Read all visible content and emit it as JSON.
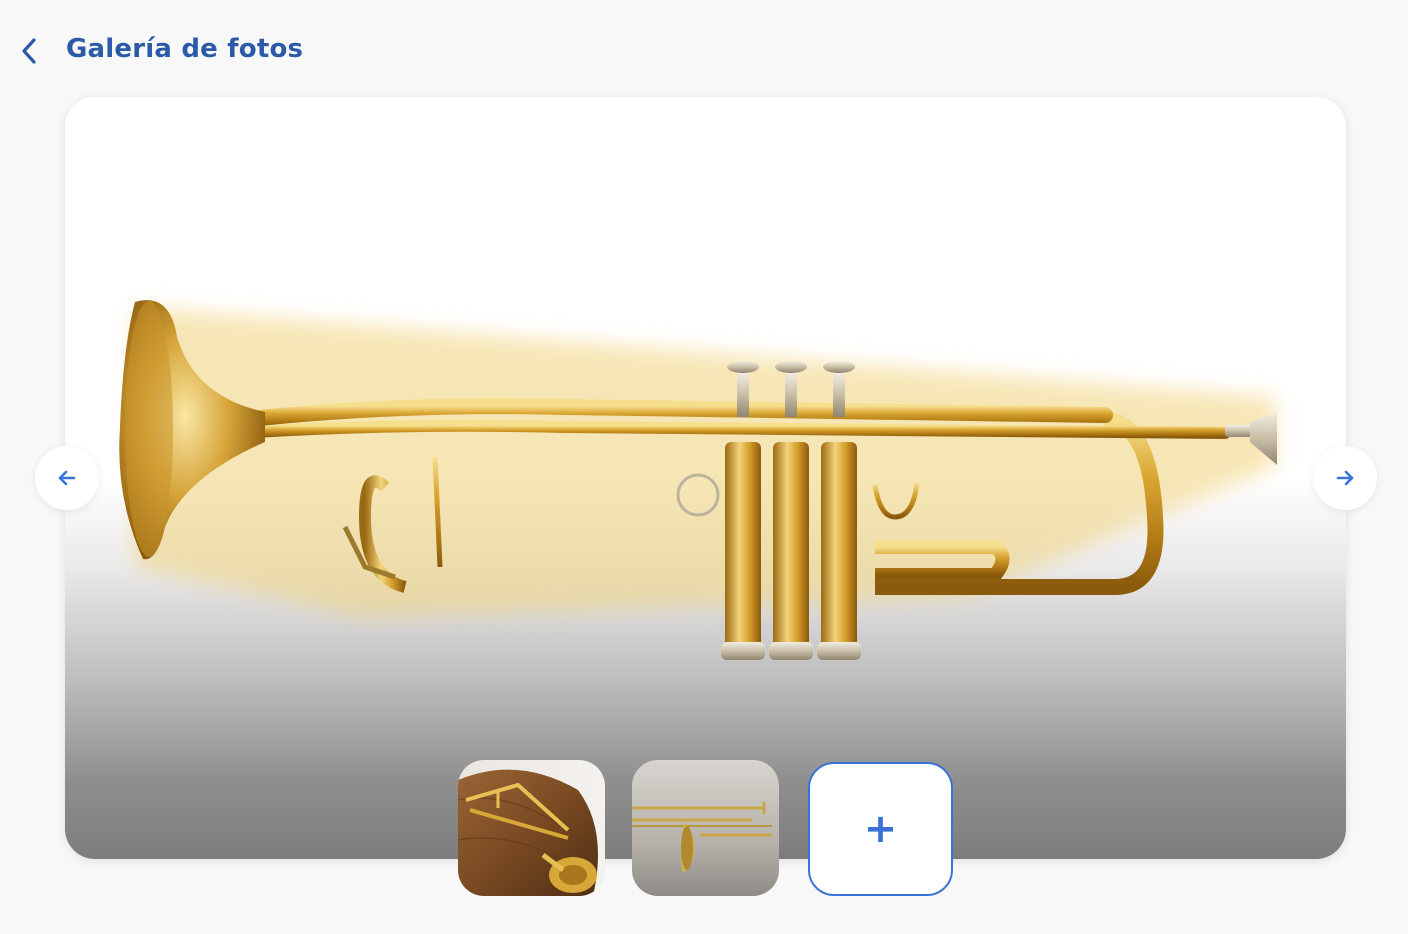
{
  "header": {
    "title": "Galería de fotos",
    "back_icon": "chevron-left-icon"
  },
  "viewer": {
    "main_image": "trumpet",
    "prev_icon": "arrow-left-icon",
    "next_icon": "arrow-right-icon"
  },
  "thumbnails": [
    {
      "image": "trombone-on-wooden-surface"
    },
    {
      "image": "trombone-on-grey-background"
    }
  ],
  "add_photo": {
    "label": "+"
  },
  "colors": {
    "accent": "#3a73d8",
    "title": "#2c5aa8",
    "background": "#f8f8f8"
  }
}
